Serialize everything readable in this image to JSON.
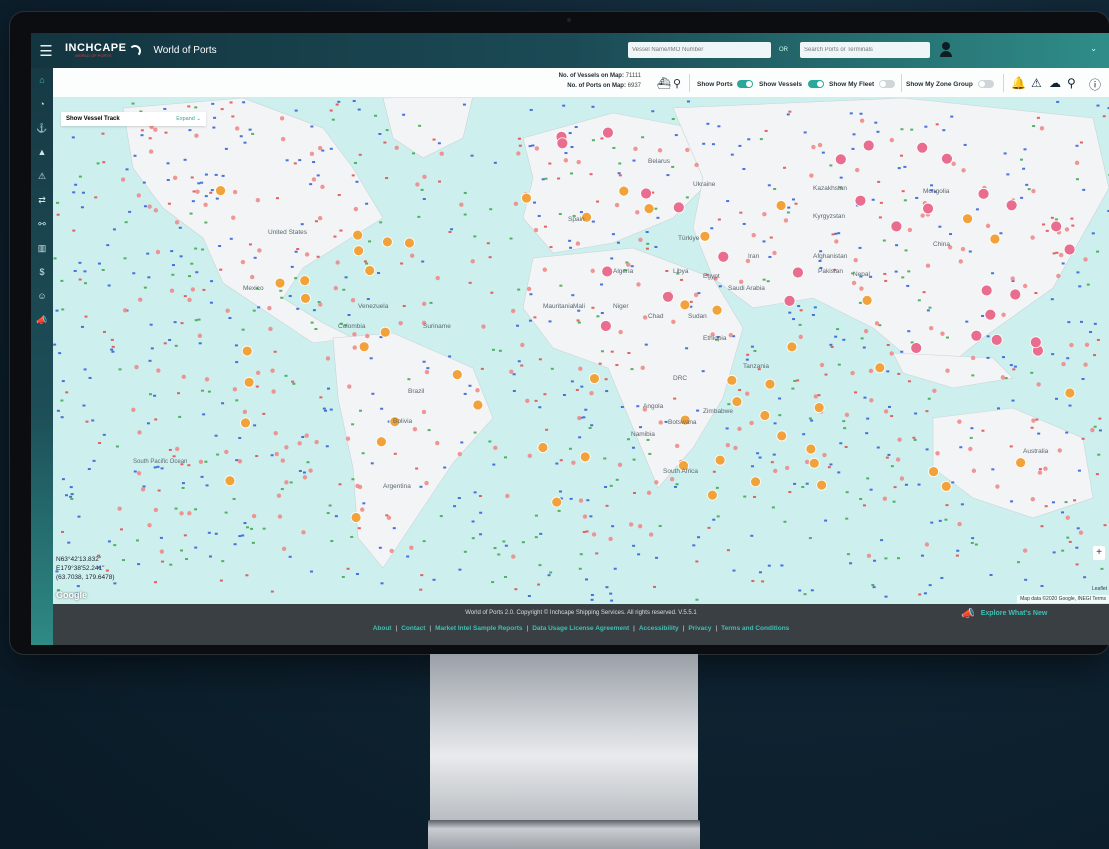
{
  "header": {
    "brand_name": "INCHCAPE",
    "brand_sub": "WORLD OF PORTS",
    "app_title": "World of Ports",
    "vessel_search_placeholder": "Vessel Name/IMO Number",
    "or_label": "OR",
    "port_search_placeholder": "Search Ports or Terminals"
  },
  "sidebar": {
    "icons": [
      "home-icon",
      "dashboard-icon",
      "anchor-icon",
      "port-icon",
      "alert-icon",
      "transfer-icon",
      "route-icon",
      "chart-icon",
      "dollar-icon",
      "user-icon",
      "megaphone-icon"
    ],
    "glyphs": [
      "⌂",
      "◔",
      "⚓",
      "▲",
      "⚠",
      "⇄",
      "⚯",
      "▥",
      "$",
      "☺",
      "📣"
    ]
  },
  "toolbar": {
    "vessels_label": "No. of Vessels on Map:",
    "vessels_count": "71111",
    "ports_label": "No. of Ports on Map:",
    "ports_count": "6937",
    "show_ports": "Show Ports",
    "show_vessels": "Show Vessels",
    "show_my_fleet": "Show My Fleet",
    "show_zone_group": "Show My Zone Group",
    "toggles": {
      "ports": true,
      "vessels": true,
      "fleet": false,
      "zone": false
    }
  },
  "vessel_track": {
    "label": "Show Vessel Track",
    "expand": "Expand ⌄"
  },
  "map": {
    "coords_line1": "N63°42'13.832\"",
    "coords_line2": "E179°38'52.241\"",
    "coords_line3": "(63.7038, 179.6478)",
    "google": "Google",
    "attribution": "Map data ©2020 Google, INEGI  Terms",
    "leaflet": "Leaflet",
    "zoom_in": "+",
    "labels": [
      "Belarus",
      "Ukraine",
      "Kazakhstan",
      "Mongolia",
      "Kyrgyzstan",
      "Türkiye",
      "Spain",
      "Afghanistan",
      "Iran",
      "China",
      "Pakistan",
      "Nepal",
      "Algeria",
      "Libya",
      "Egypt",
      "Saudi Arabia",
      "Mali",
      "Niger",
      "Chad",
      "Sudan",
      "Mauritania",
      "Ethiopia",
      "United States",
      "Mexico",
      "Venezuela",
      "Colombia",
      "Suriname",
      "DRC",
      "Angola",
      "Namibia",
      "Botswana",
      "Zimbabwe",
      "South Africa",
      "Brazil",
      "Bolivia",
      "Argentina",
      "Australia",
      "South Pacific Ocean",
      "Tanzania"
    ]
  },
  "footer": {
    "copyright": "World of Ports 2.0. Copyright © Inchcape Shipping Services. All rights reserved. V.5.5.1",
    "links": [
      "About",
      "Contact",
      "Market Intel Sample Reports",
      "Data Usage License Agreement",
      "Accessibility",
      "Privacy",
      "Terms and Conditions"
    ],
    "whats_new": "Explore What's New"
  }
}
